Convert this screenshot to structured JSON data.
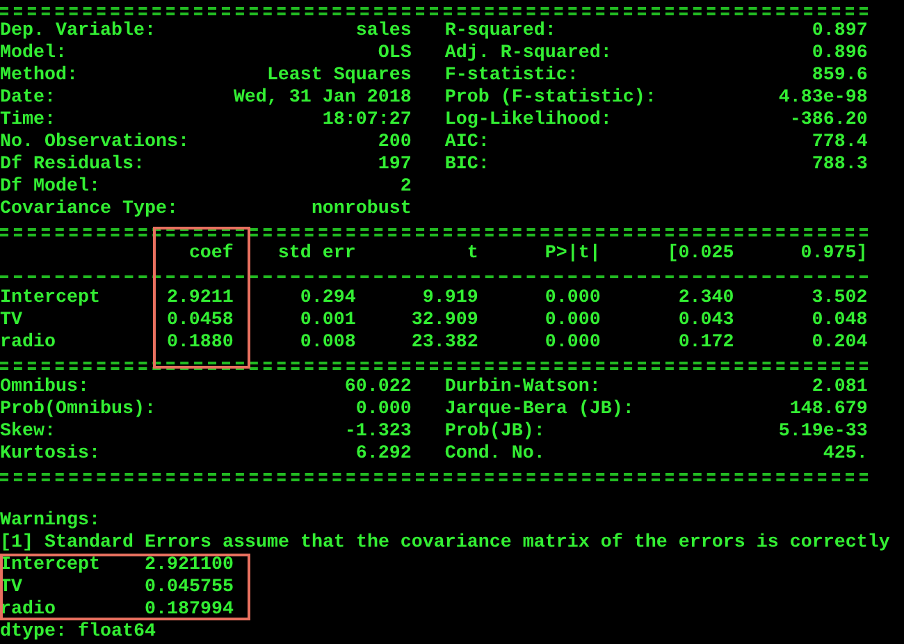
{
  "model_summary": {
    "left": [
      {
        "label": "Dep. Variable:",
        "value": "sales"
      },
      {
        "label": "Model:",
        "value": "OLS"
      },
      {
        "label": "Method:",
        "value": "Least Squares"
      },
      {
        "label": "Date:",
        "value": "Wed, 31 Jan 2018"
      },
      {
        "label": "Time:",
        "value": "18:07:27"
      },
      {
        "label": "No. Observations:",
        "value": "200"
      },
      {
        "label": "Df Residuals:",
        "value": "197"
      },
      {
        "label": "Df Model:",
        "value": "2"
      },
      {
        "label": "Covariance Type:",
        "value": "nonrobust"
      }
    ],
    "right": [
      {
        "label": "R-squared:",
        "value": "0.897"
      },
      {
        "label": "Adj. R-squared:",
        "value": "0.896"
      },
      {
        "label": "F-statistic:",
        "value": "859.6"
      },
      {
        "label": "Prob (F-statistic):",
        "value": "4.83e-98"
      },
      {
        "label": "Log-Likelihood:",
        "value": "-386.20"
      },
      {
        "label": "AIC:",
        "value": "778.4"
      },
      {
        "label": "BIC:",
        "value": "788.3"
      }
    ]
  },
  "coefficients": {
    "columns": [
      {
        "label": "coef",
        "highlighted": true
      },
      {
        "label": "std err",
        "highlighted": false
      },
      {
        "label": "t",
        "highlighted": false
      },
      {
        "label": "P>|t|",
        "highlighted": false
      },
      {
        "label": "[0.025",
        "highlighted": false
      },
      {
        "label": "0.975]",
        "highlighted": false
      }
    ],
    "rows": [
      {
        "name": "Intercept",
        "values": [
          "2.9211",
          "0.294",
          "9.919",
          "0.000",
          "2.340",
          "3.502"
        ]
      },
      {
        "name": "TV",
        "values": [
          "0.0458",
          "0.001",
          "32.909",
          "0.000",
          "0.043",
          "0.048"
        ]
      },
      {
        "name": "radio",
        "values": [
          "0.1880",
          "0.008",
          "23.382",
          "0.000",
          "0.172",
          "0.204"
        ]
      }
    ]
  },
  "diagnostics": {
    "left": [
      {
        "label": "Omnibus:",
        "value": "60.022"
      },
      {
        "label": "Prob(Omnibus):",
        "value": "0.000"
      },
      {
        "label": "Skew:",
        "value": "-1.323"
      },
      {
        "label": "Kurtosis:",
        "value": "6.292"
      }
    ],
    "right": [
      {
        "label": "Durbin-Watson:",
        "value": "2.081"
      },
      {
        "label": "Jarque-Bera (JB):",
        "value": "148.679"
      },
      {
        "label": "Prob(JB):",
        "value": "5.19e-33"
      },
      {
        "label": "Cond. No.",
        "value": "425."
      }
    ]
  },
  "warnings": {
    "title": "Warnings:",
    "notes": [
      "[1] Standard Errors assume that the covariance matrix of the errors is correctly"
    ]
  },
  "params_series": {
    "highlighted": true,
    "rows": [
      {
        "name": "Intercept",
        "value": "2.921100"
      },
      {
        "name": "TV",
        "value": "0.045755"
      },
      {
        "name": "radio",
        "value": "0.187994"
      }
    ],
    "dtype": "dtype: float64"
  }
}
